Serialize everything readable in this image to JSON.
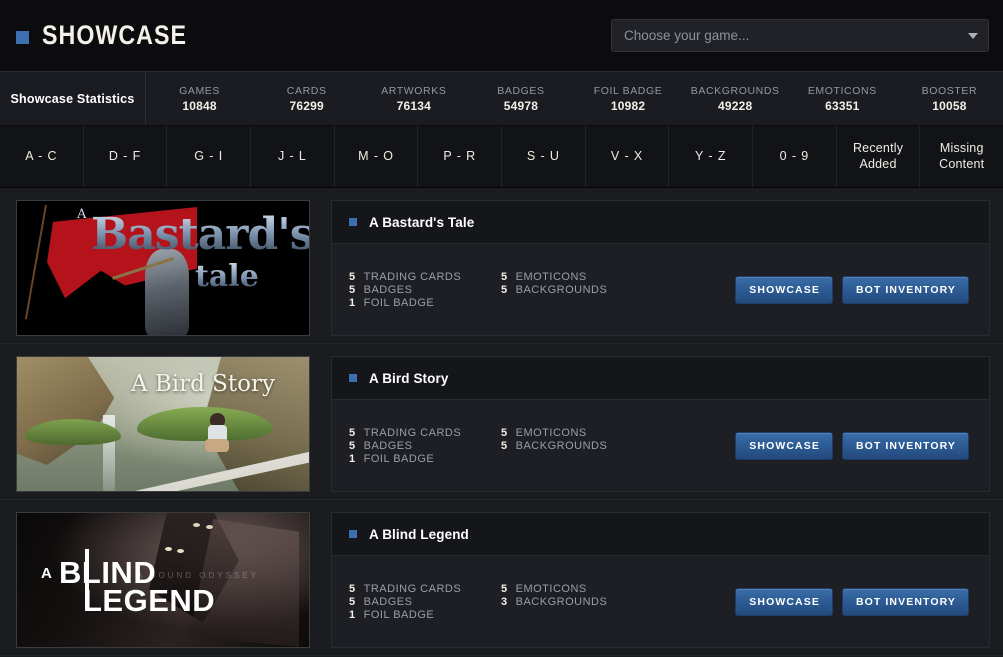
{
  "header": {
    "brand_title": "SHOWCASE",
    "brand_icon": "blue-square-icon",
    "accent_color": "#3c6eb0",
    "game_picker": {
      "placeholder": "Choose your game...",
      "value": "Choose your game...",
      "caret_icon": "chevron-down-icon"
    }
  },
  "stats": {
    "title": "Showcase Statistics",
    "items": [
      {
        "label": "GAMES",
        "value": "10848"
      },
      {
        "label": "CARDS",
        "value": "76299"
      },
      {
        "label": "ARTWORKS",
        "value": "76134"
      },
      {
        "label": "BADGES",
        "value": "54978"
      },
      {
        "label": "FOIL BADGE",
        "value": "10982"
      },
      {
        "label": "BACKGROUNDS",
        "value": "49228"
      },
      {
        "label": "EMOTICONS",
        "value": "63351"
      },
      {
        "label": "BOOSTER",
        "value": "10058"
      }
    ]
  },
  "alpha_nav": {
    "items": [
      {
        "label": "A - C"
      },
      {
        "label": "D - F"
      },
      {
        "label": "G - I"
      },
      {
        "label": "J - L"
      },
      {
        "label": "M - O"
      },
      {
        "label": "P - R"
      },
      {
        "label": "S - U"
      },
      {
        "label": "V - X"
      },
      {
        "label": "Y - Z"
      },
      {
        "label": "0 - 9"
      },
      {
        "label": "Recently\nAdded"
      },
      {
        "label": "Missing\nContent"
      }
    ]
  },
  "buttons": {
    "showcase": "SHOWCASE",
    "bot_inventory": "BOT INVENTORY"
  },
  "labels": {
    "trading_cards": "TRADING CARDS",
    "badges": "BADGES",
    "foil_badge": "FOIL BADGE",
    "emoticons": "EMOTICONS",
    "backgrounds": "BACKGROUNDS"
  },
  "games": [
    {
      "title": "A Bastard's Tale",
      "banner_text_1": "A",
      "banner_text_2": "Bastard's",
      "banner_text_3": "tale",
      "trading_cards": "5",
      "badges": "5",
      "foil_badge": "1",
      "emoticons": "5",
      "backgrounds": "5"
    },
    {
      "title": "A Bird Story",
      "banner_text_1": "A Bird Story",
      "trading_cards": "5",
      "badges": "5",
      "foil_badge": "1",
      "emoticons": "5",
      "backgrounds": "5"
    },
    {
      "title": "A Blind Legend",
      "banner_text_1": "A",
      "banner_text_2": "BLIND",
      "banner_text_3": "LEGEND",
      "banner_text_4": "A SOUND ODYSSEY",
      "trading_cards": "5",
      "badges": "5",
      "foil_badge": "1",
      "emoticons": "5",
      "backgrounds": "3"
    }
  ]
}
